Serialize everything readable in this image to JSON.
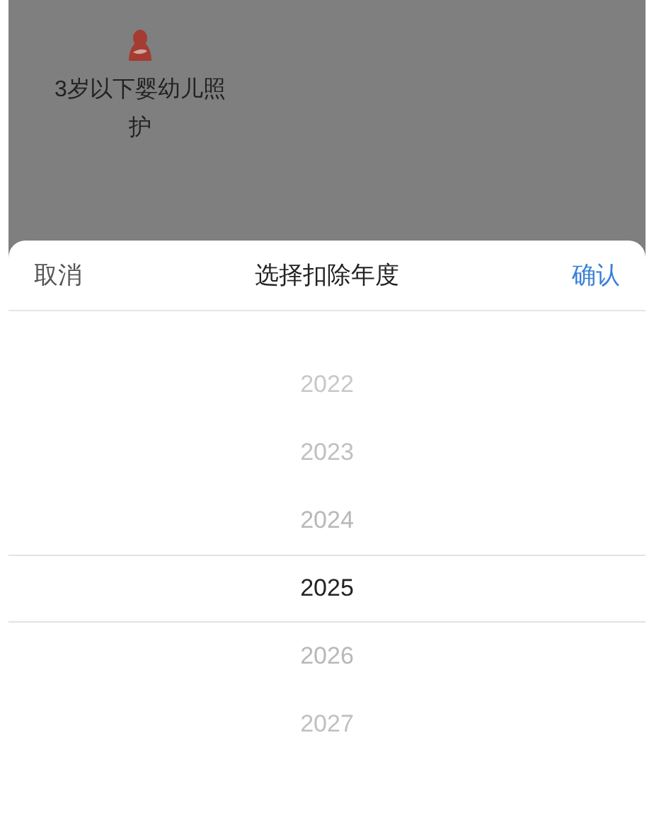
{
  "background_item": {
    "label": "3岁以下婴幼儿照护"
  },
  "picker": {
    "cancel": "取消",
    "title": "选择扣除年度",
    "confirm": "确认",
    "years": [
      {
        "label": "2022",
        "selected": false
      },
      {
        "label": "2023",
        "selected": false
      },
      {
        "label": "2024",
        "selected": false
      },
      {
        "label": "2025",
        "selected": true
      },
      {
        "label": "2026",
        "selected": false
      },
      {
        "label": "2027",
        "selected": false
      }
    ]
  }
}
